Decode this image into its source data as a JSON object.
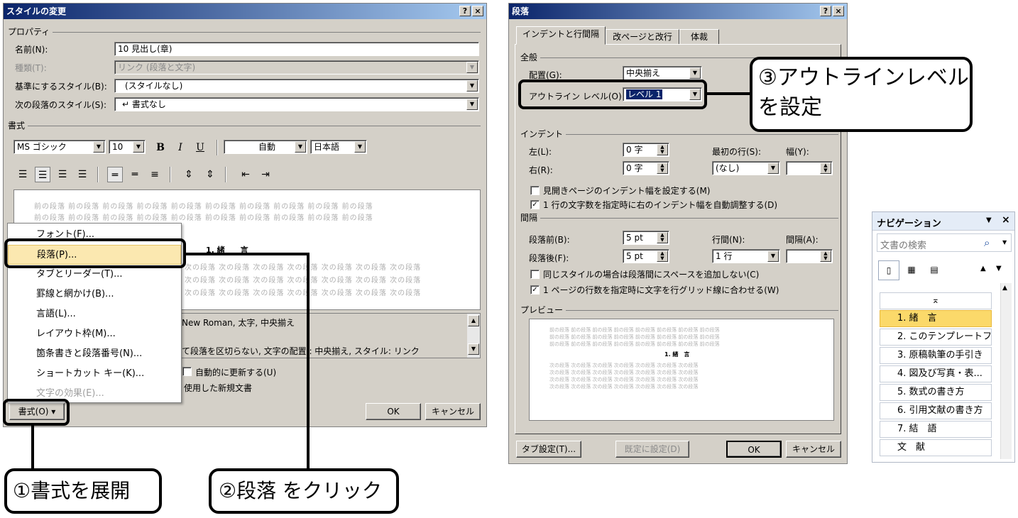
{
  "dialog1": {
    "title": "スタイルの変更",
    "help": "?",
    "close": "×",
    "properties_label": "プロパティ",
    "name_label": "名前(N):",
    "name_value": "10 見出し(章)",
    "type_label": "種類(T):",
    "type_value": "リンク (段落と文字)",
    "based_label": "基準にするスタイル(B):",
    "based_value": "(スタイルなし)",
    "next_label": "次の段落のスタイル(S):",
    "next_value": "↵ 書式なし",
    "format_label": "書式",
    "font_name": "MS ゴシック",
    "font_size": "10",
    "bold": "B",
    "italic": "I",
    "underline": "U",
    "color": "自動",
    "language": "日本語",
    "preview_prev": "前の段落 前の段落 前の段落 前の段落 前の段落 前の段落 前の段落 前の段落 前の段落 前の段落",
    "preview_heading": "1. 緒　　言",
    "preview_next": "次の段落 次の段落 次の段落 次の段落 次の段落 次の段落 次の段落",
    "desc1": "New Roman, 太字, 中央揃え",
    "desc2": "て段落を区切らない, 文字の配置 : 中央揃え, スタイル: リンク",
    "auto_update": "自動的に更新する(U)",
    "new_docs": "使用した新規文書",
    "format_button": "書式(O) ▾",
    "ok": "OK",
    "cancel": "キャンセル"
  },
  "format_menu": {
    "items": [
      {
        "label": "フォント(F)..."
      },
      {
        "label": "段落(P)..."
      },
      {
        "label": "タブとリーダー(T)..."
      },
      {
        "label": "罫線と網かけ(B)..."
      },
      {
        "label": "言語(L)..."
      },
      {
        "label": "レイアウト枠(M)..."
      },
      {
        "label": "箇条書きと段落番号(N)..."
      },
      {
        "label": "ショートカット キー(K)..."
      },
      {
        "label": "文字の効果(E)..."
      }
    ]
  },
  "dialog2": {
    "title": "段落",
    "help": "?",
    "close": "×",
    "tabs": [
      "インデントと行間隔",
      "改ページと改行",
      "体裁"
    ],
    "general_label": "全般",
    "alignment_label": "配置(G):",
    "alignment_value": "中央揃え",
    "outline_label": "アウトライン レベル(O):",
    "outline_value": "レベル 1",
    "indent_label": "インデント",
    "left_label": "左(L):",
    "left_value": "0 字",
    "right_label": "右(R):",
    "right_value": "0 字",
    "first_label": "最初の行(S):",
    "first_value": "(なし)",
    "width_label": "幅(Y):",
    "mirror": "見開きページのインデント幅を設定する(M)",
    "auto_indent": "1 行の文字数を指定時に右のインデント幅を自動調整する(D)",
    "spacing_label": "間隔",
    "before_label": "段落前(B):",
    "before_value": "5 pt",
    "after_label": "段落後(F):",
    "after_value": "5 pt",
    "line_label": "行間(N):",
    "line_value": "1 行",
    "at_label": "間隔(A):",
    "no_space": "同じスタイルの場合は段落間にスペースを追加しない(C)",
    "grid": "1 ページの行数を指定時に文字を行グリッド線に合わせる(W)",
    "preview_label": "プレビュー",
    "preview_prev": "前の段落 前の段落 前の段落 前の段落 前の段落 前の段落 前の段落 前の段落",
    "preview_heading": "1. 緒　言",
    "preview_next": "次の段落 次の段落 次の段落 次の段落 次の段落 次の段落 次の段落",
    "tab_button": "タブ設定(T)...",
    "default_button": "既定に設定(D)",
    "ok": "OK",
    "cancel": "キャンセル"
  },
  "nav_pane": {
    "title": "ナビゲーション",
    "search_placeholder": "文書の検索",
    "items": [
      {
        "label": "1. 緒　言"
      },
      {
        "label": "2. このテンプレートフ..."
      },
      {
        "label": "3. 原稿執筆の手引き"
      },
      {
        "label": "4. 図及び写真・表..."
      },
      {
        "label": "5. 数式の書き方"
      },
      {
        "label": "6. 引用文献の書き方"
      },
      {
        "label": "7. 結　語"
      },
      {
        "label": "文　献"
      }
    ]
  },
  "callouts": {
    "c1": "①書式を展開",
    "c2": "②段落 をクリック",
    "c3_line1": "③アウトラインレベル",
    "c3_line2": "を設定"
  }
}
